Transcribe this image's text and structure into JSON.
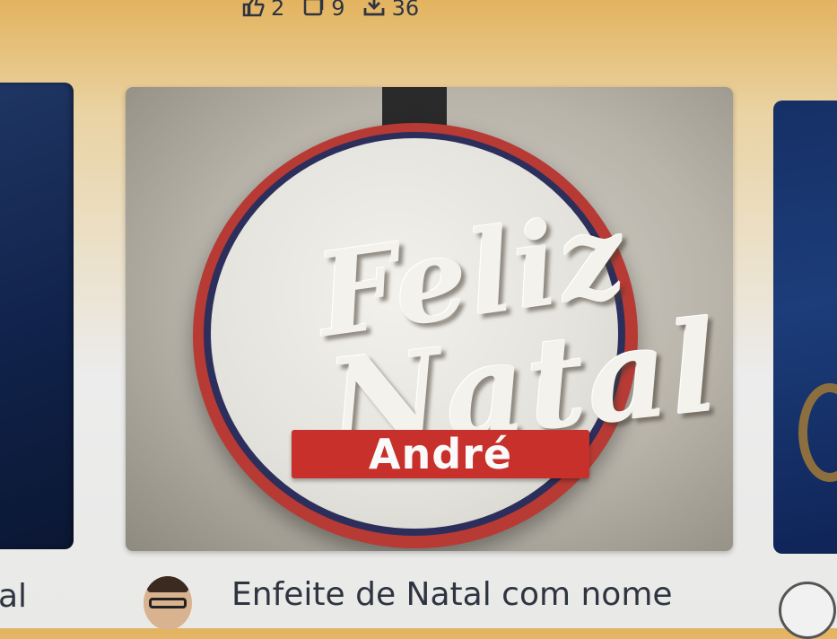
{
  "stats": {
    "likes": "2",
    "collections": "9",
    "downloads": "36",
    "icons": [
      "like-icon",
      "collection-icon",
      "download-icon"
    ]
  },
  "main_card": {
    "image_text_line1": "Feliz",
    "image_text_line2": "Natal",
    "image_name": "André",
    "colors": {
      "ornament_border": "#b73a35",
      "ornament_face": "#eeeee8",
      "banner": "#c8302b"
    }
  },
  "footer": {
    "left_partial_text": "al",
    "title": "Enfeite de Natal com nome"
  }
}
